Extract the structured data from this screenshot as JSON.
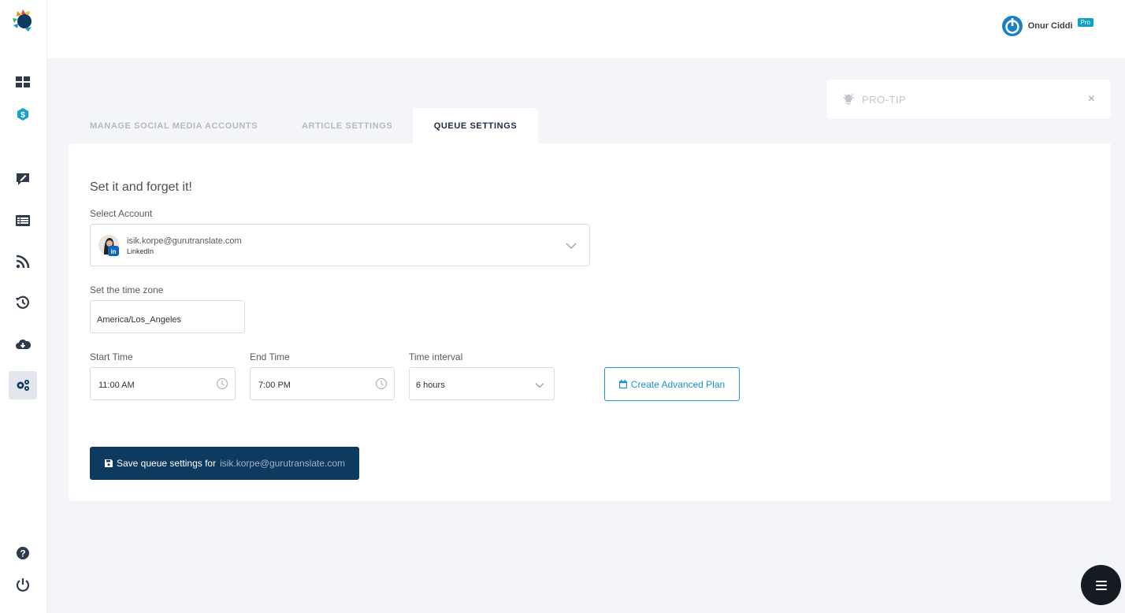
{
  "user": {
    "name": "Onur Ciddi",
    "badge": "Pro"
  },
  "protip": {
    "label": "PRO-TIP",
    "close": "×"
  },
  "tabs": [
    {
      "label": "MANAGE SOCIAL MEDIA ACCOUNTS"
    },
    {
      "label": "ARTICLE SETTINGS"
    },
    {
      "label": "QUEUE SETTINGS"
    }
  ],
  "panel": {
    "title": "Set it and forget it!",
    "account_label": "Select Account",
    "account": {
      "email": "isik.korpe@gurutranslate.com",
      "type": "LinkedIn"
    },
    "timezone_label": "Set the time zone",
    "timezone": "America/Los_Angeles",
    "start_label": "Start Time",
    "start_value": "11:00 AM",
    "end_label": "End Time",
    "end_value": "7:00 PM",
    "interval_label": "Time interval",
    "interval_value": "6 hours",
    "advanced_button": "Create Advanced Plan",
    "save_button": "Save queue settings for",
    "save_email": "isik.korpe@gurutranslate.com"
  },
  "sidebar": {
    "items": [
      "dashboard-icon",
      "dollar-icon",
      "compose-icon",
      "list-icon",
      "rss-icon",
      "history-icon",
      "cloud-download-icon",
      "settings-icon",
      "help-icon",
      "power-icon"
    ]
  },
  "colors": {
    "primary": "#0d3a5e",
    "accent": "#1a93cf",
    "badge": "#0fa0c8"
  }
}
